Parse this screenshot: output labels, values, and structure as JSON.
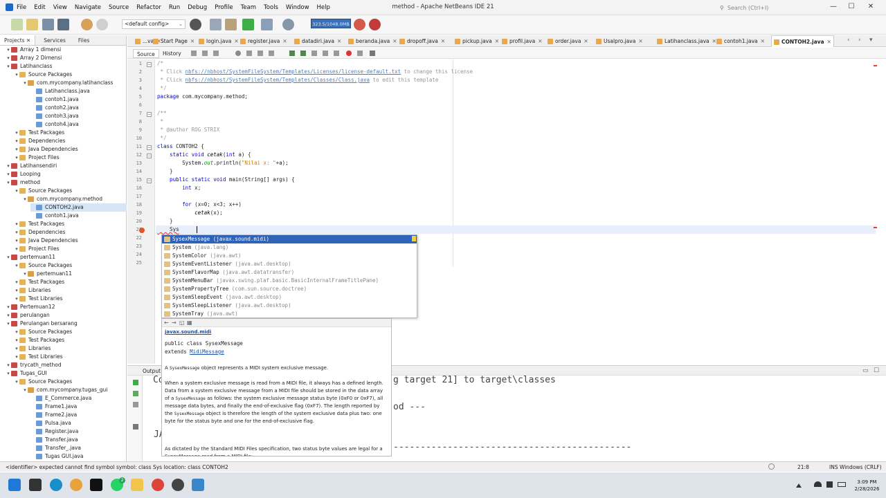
{
  "window": {
    "title": "method - Apache NetBeans IDE 21",
    "search_placeholder": "Search (Ctrl+I)",
    "menu": [
      "File",
      "Edit",
      "View",
      "Navigate",
      "Source",
      "Refactor",
      "Run",
      "Debug",
      "Profile",
      "Team",
      "Tools",
      "Window",
      "Help"
    ],
    "controls": {
      "minimize": "—",
      "maximize": "☐",
      "close": "✕"
    }
  },
  "toolbar": {
    "config": "<default config>",
    "memory": "323.5/1048.0MB"
  },
  "left_panel": {
    "tabs": [
      "Projects",
      "Services",
      "Files"
    ],
    "tree": [
      {
        "label": "Array 1 dimensi",
        "depth": 0,
        "icon": "project"
      },
      {
        "label": "Array 2 Dimensi",
        "depth": 0,
        "icon": "project"
      },
      {
        "label": "Latihanclass",
        "depth": 0,
        "icon": "project"
      },
      {
        "label": "Source Packages",
        "depth": 1,
        "icon": "folder"
      },
      {
        "label": "com.mycompany.latihanclass",
        "depth": 2,
        "icon": "package"
      },
      {
        "label": "Latihanclass.java",
        "depth": 3,
        "icon": "java"
      },
      {
        "label": "contoh1.java",
        "depth": 3,
        "icon": "java"
      },
      {
        "label": "contoh2.java",
        "depth": 3,
        "icon": "java"
      },
      {
        "label": "contoh3.java",
        "depth": 3,
        "icon": "java"
      },
      {
        "label": "contoh4.java",
        "depth": 3,
        "icon": "java"
      },
      {
        "label": "Test Packages",
        "depth": 1,
        "icon": "folder"
      },
      {
        "label": "Dependencies",
        "depth": 1,
        "icon": "folder"
      },
      {
        "label": "Java Dependencies",
        "depth": 1,
        "icon": "folder"
      },
      {
        "label": "Project Files",
        "depth": 1,
        "icon": "folder"
      },
      {
        "label": "Latihansendiri",
        "depth": 0,
        "icon": "project"
      },
      {
        "label": "Looping",
        "depth": 0,
        "icon": "project"
      },
      {
        "label": "method",
        "depth": 0,
        "icon": "project"
      },
      {
        "label": "Source Packages",
        "depth": 1,
        "icon": "folder"
      },
      {
        "label": "com.mycompany.method",
        "depth": 2,
        "icon": "package"
      },
      {
        "label": "CONTOH2.java",
        "depth": 3,
        "icon": "java",
        "selected": true
      },
      {
        "label": "contoh1.java",
        "depth": 3,
        "icon": "java"
      },
      {
        "label": "Test Packages",
        "depth": 1,
        "icon": "folder"
      },
      {
        "label": "Dependencies",
        "depth": 1,
        "icon": "folder"
      },
      {
        "label": "Java Dependencies",
        "depth": 1,
        "icon": "folder"
      },
      {
        "label": "Project Files",
        "depth": 1,
        "icon": "folder"
      },
      {
        "label": "pertemuan11",
        "depth": 0,
        "icon": "project"
      },
      {
        "label": "Source Packages",
        "depth": 1,
        "icon": "folder"
      },
      {
        "label": "pertemuan11",
        "depth": 2,
        "icon": "package"
      },
      {
        "label": "Test Packages",
        "depth": 1,
        "icon": "folder"
      },
      {
        "label": "Libraries",
        "depth": 1,
        "icon": "folder"
      },
      {
        "label": "Test Libraries",
        "depth": 1,
        "icon": "folder"
      },
      {
        "label": "Pertemuan12",
        "depth": 0,
        "icon": "project"
      },
      {
        "label": "perulangan",
        "depth": 0,
        "icon": "project"
      },
      {
        "label": "Perulangan bersarang",
        "depth": 0,
        "icon": "project"
      },
      {
        "label": "Source Packages",
        "depth": 1,
        "icon": "folder"
      },
      {
        "label": "Test Packages",
        "depth": 1,
        "icon": "folder"
      },
      {
        "label": "Libraries",
        "depth": 1,
        "icon": "folder"
      },
      {
        "label": "Test Libraries",
        "depth": 1,
        "icon": "folder"
      },
      {
        "label": "trycath_method",
        "depth": 0,
        "icon": "project"
      },
      {
        "label": "Tugas_GUI",
        "depth": 0,
        "icon": "project"
      },
      {
        "label": "Source Packages",
        "depth": 1,
        "icon": "folder"
      },
      {
        "label": "com.mycompany.tugas_gui",
        "depth": 2,
        "icon": "package"
      },
      {
        "label": "E_Commerce.java",
        "depth": 3,
        "icon": "java"
      },
      {
        "label": "Frame1.java",
        "depth": 3,
        "icon": "java"
      },
      {
        "label": "Frame2.java",
        "depth": 3,
        "icon": "java"
      },
      {
        "label": "Pulsa.java",
        "depth": 3,
        "icon": "java"
      },
      {
        "label": "Register.java",
        "depth": 3,
        "icon": "java"
      },
      {
        "label": "Transfer.java",
        "depth": 3,
        "icon": "java"
      },
      {
        "label": "Transfer_.java",
        "depth": 3,
        "icon": "java"
      },
      {
        "label": "Tugas GUI.java",
        "depth": 3,
        "icon": "java"
      }
    ]
  },
  "editor": {
    "tabs": [
      "...va",
      "Start Page",
      "login.java",
      "register.java",
      "datadiri.java",
      "beranda.java",
      "dropoff.java",
      "pickup.java",
      "profil.java",
      "order.java",
      "Usalpro.java",
      "Latihanclass.java",
      "contoh1.java",
      "CONTOH2.java"
    ],
    "active_tab": "CONTOH2.java",
    "subtabs": [
      "Source",
      "History"
    ],
    "line_numbers": [
      "1",
      "2",
      "3",
      "4",
      "5",
      "6",
      "7",
      "8",
      "9",
      "10",
      "11",
      "12",
      "13",
      "14",
      "15",
      "16",
      "17",
      "18",
      "19",
      "20",
      "21",
      "22",
      "23",
      "24",
      "25"
    ],
    "code": {
      "l1": "/*",
      "l2a": " * Click ",
      "l2b": "nbfs://nbhost/SystemFileSystem/Templates/Licenses/license-default.txt",
      "l2c": " to change this license",
      "l3a": " * Click ",
      "l3b": "nbfs://nbhost/SystemFileSystem/Templates/Classes/Class.java",
      "l3c": " to edit this template",
      "l4": " */",
      "l5a": "package",
      "l5b": " com.mycompany.method;",
      "l7": "/**",
      "l8": " *",
      "l9": " * @author ROG STRIX",
      "l10": " */",
      "l11a": "class",
      "l11b": " CONTOH2 {",
      "l12a": "    static void ",
      "l12b": "cetak",
      "l12c": "(",
      "l12d": "int",
      "l12e": " a) {",
      "l13a": "        System.",
      "l13b": "out",
      "l13c": ".println(",
      "l13d": "\"Nilai x: \"",
      "l13e": "+a);",
      "l14": "    }",
      "l15a": "    public static void ",
      "l15b": "main(String[] args) {",
      "l16a": "        int",
      "l16b": " x;",
      "l18a": "        for",
      "l18b": " (x=0; x<3; x++)",
      "l19a": "            ",
      "l19b": "cetak",
      "l19c": "(x);",
      "l20": "    }",
      "l21": "    Sys",
      "l24": "    }",
      "l25": ""
    }
  },
  "completion": {
    "items": [
      {
        "name": "SysexMessage",
        "pkg": "(javax.sound.midi)"
      },
      {
        "name": "System",
        "pkg": "(java.lang)"
      },
      {
        "name": "SystemColor",
        "pkg": "(java.awt)"
      },
      {
        "name": "SystemEventListener",
        "pkg": "(java.awt.desktop)"
      },
      {
        "name": "SystemFlavorMap",
        "pkg": "(java.awt.datatransfer)"
      },
      {
        "name": "SystemMenuBar",
        "pkg": "(javax.swing.plaf.basic.BasicInternalFrameTitlePane)"
      },
      {
        "name": "SystemPropertyTree",
        "pkg": "(com.sun.source.doctree)"
      },
      {
        "name": "SystemSleepEvent",
        "pkg": "(java.awt.desktop)"
      },
      {
        "name": "SystemSleepListener",
        "pkg": "(java.awt.desktop)"
      },
      {
        "name": "SystemTray",
        "pkg": "(java.awt)"
      }
    ]
  },
  "doc": {
    "package_link": "javax.sound.midi",
    "sig1": "public class SysexMessage",
    "sig2a": "extends ",
    "sig2b": "MidiMessage",
    "p1a": "A ",
    "p1b": "SysexMessage",
    "p1c": " object represents a MIDI system exclusive message.",
    "p2a": "When a system exclusive message is read from a MIDI file, it always has a defined length. Data from a system exclusive message from a MIDI file should be stored in the data array of a ",
    "p2b": "SysexMessage",
    "p2c": " as follows: the system exclusive message status byte (0xF0 or 0xF7), all message data bytes, and finally the end-of-exclusive flag (0xF7). The length reported by the ",
    "p2d": "SysexMessage",
    "p2e": " object is therefore the length of the system exclusive data plus two: one byte for the status byte and one for the end-of-exclusive flag.",
    "p3": "As dictated by the Standard MIDI Files specification, two status byte values are legal for a SysexMessage read from a MIDI file:"
  },
  "output": {
    "title": "Output",
    "lines": [
      "Co",
      "g target 21] to target\\classes",
      "od ---",
      "JA",
      "--------------------------------------------"
    ]
  },
  "status": {
    "message": "<identifier> expected  cannot find symbol  symbol: class Sys  location: class CONTOH2",
    "position": "21:8",
    "mode": "INS Windows (CRLF)"
  },
  "taskbar": {
    "time": "3:09 PM",
    "date": "2/28/2026",
    "badge": "2"
  },
  "colors": {
    "accent": "#2e63b8",
    "selection": "#d7e6f7",
    "memory_bar": "#3b6fb6"
  }
}
